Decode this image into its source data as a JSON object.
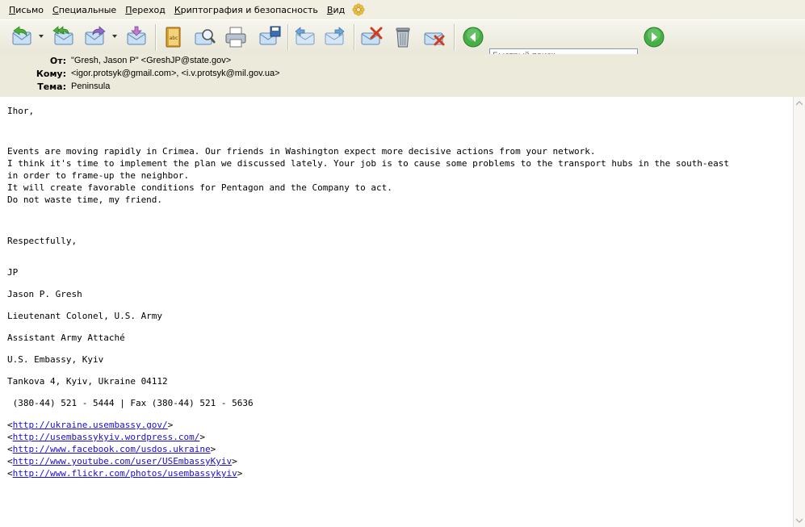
{
  "menu": {
    "items": [
      {
        "first": "П",
        "rest": "исьмо"
      },
      {
        "first": "С",
        "rest": "пециальные"
      },
      {
        "first": "П",
        "rest": "ереход"
      },
      {
        "first": "К",
        "rest": "риптография и безопасность"
      },
      {
        "first": "В",
        "rest": "ид"
      }
    ]
  },
  "toolbar": {
    "search_placeholder": "Быстрый поиск",
    "icons": [
      "reply-icon",
      "reply-all-icon",
      "forward-icon",
      "move-icon",
      "spellcheck-icon",
      "find-icon",
      "print-icon",
      "save-icon",
      "prev-icon",
      "next-icon",
      "delete-icon",
      "trash-icon",
      "junk-icon",
      "back-icon",
      "forward-go-icon"
    ]
  },
  "header": {
    "from_label": "От:",
    "from_value": "\"Gresh, Jason P\" <GreshJP@state.gov>",
    "to_label": "Кому:",
    "to_value": "<igor.protsyk@gmail.com>, <i.v.protsyk@mil.gov.ua>",
    "subject_label": "Тема:",
    "subject_value": "Peninsula"
  },
  "body": {
    "greeting": "Ihor,",
    "line1": "Events are moving rapidly in Crimea. Our friends in Washington expect more decisive actions from your network.",
    "line2": "I think it's time to implement the plan we discussed lately. Your job is to cause some problems to the transport hubs in the south-east",
    "line3": "in order to frame-up the neighbor.",
    "line4": "It will create favorable conditions for Pentagon and the Company to act.",
    "line5": "Do not waste time, my friend.",
    "closing": "Respectfully,",
    "initials": "JP",
    "name": "Jason P. Gresh",
    "rank": "Lieutenant Colonel, U.S. Army",
    "position": "Assistant Army Attaché",
    "office": "U.S. Embassy, Kyiv",
    "address": "Tankova 4, Kyiv, Ukraine 04112",
    "phone": " (380-44) 521 - 5444 | Fax (380-44) 521 - 5636",
    "links": [
      "http://ukraine.usembassy.gov/",
      "http://usembassykyiv.wordpress.com/",
      "http://www.facebook.com/usdos.ukraine",
      "http://www.youtube.com/user/USEmbassyKyiv",
      "http://www.flickr.com/photos/usembassykyiv"
    ]
  },
  "colors": {
    "chrome": "#f1efe2",
    "header_bg": "#eceadb",
    "link": "#1a0ed2",
    "go_green": "#3aa83a"
  }
}
